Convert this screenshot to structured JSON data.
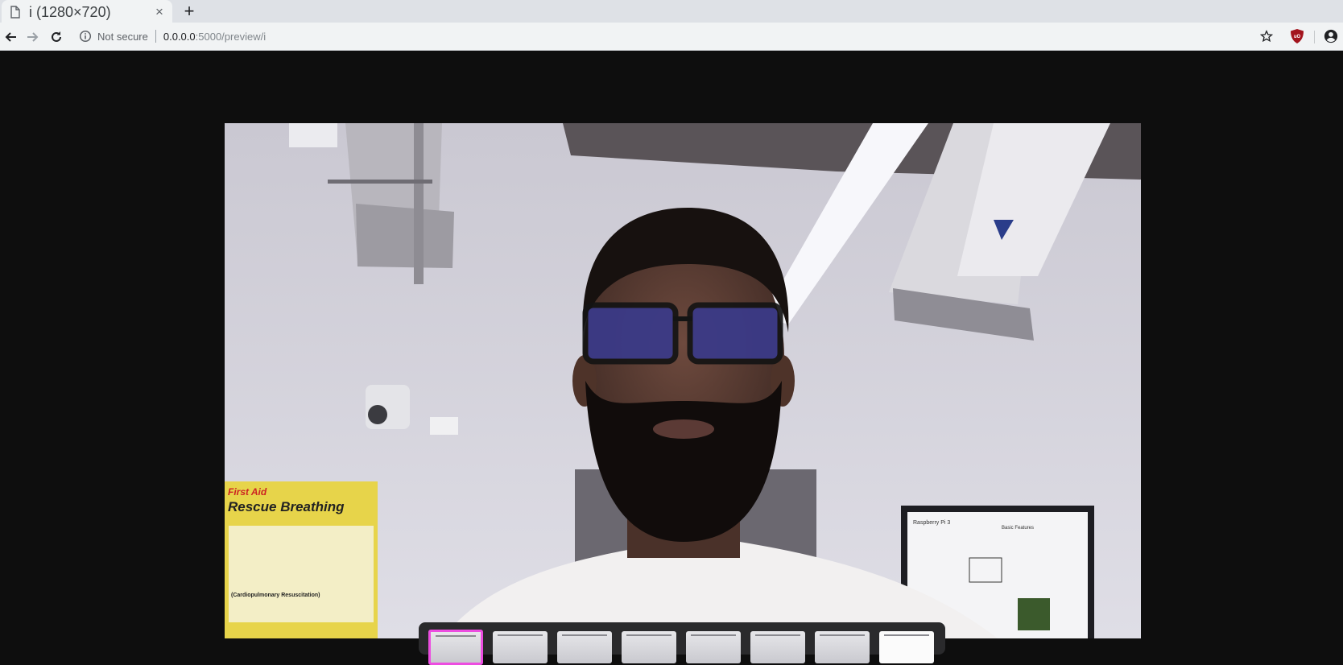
{
  "tab": {
    "title": "i (1280×720)",
    "close_glyph": "×",
    "new_tab_glyph": "+",
    "icon": "document-icon"
  },
  "toolbar": {
    "back_icon": "back-arrow-icon",
    "forward_icon": "forward-arrow-icon",
    "reload_icon": "reload-icon",
    "security_label": "Not secure",
    "url_host": "0.0.0.0",
    "url_rest": ":5000/preview/i",
    "bookmark_icon": "star-icon",
    "extension_icon": "ublock-origin-icon",
    "account_icon": "account-icon"
  },
  "viewer": {
    "image_alt": "Camera preview photo",
    "poster_text": {
      "heading_small": "First Aid",
      "heading_large": "Rescue Breathing",
      "section": "(Cardiopulmonary Resuscitation)"
    },
    "frame_text": {
      "title": "Raspberry Pi 3",
      "subtitle": "Basic Features"
    },
    "thumbnails": [
      {
        "state": "active"
      },
      {
        "state": "normal"
      },
      {
        "state": "normal"
      },
      {
        "state": "normal"
      },
      {
        "state": "normal"
      },
      {
        "state": "normal"
      },
      {
        "state": "normal"
      },
      {
        "state": "document"
      }
    ]
  },
  "colors": {
    "page_background": "#0e0e0e",
    "chrome_tabstrip": "#dee1e6",
    "chrome_toolbar": "#f1f3f4",
    "thumbnail_highlight": "#ec4de0"
  }
}
